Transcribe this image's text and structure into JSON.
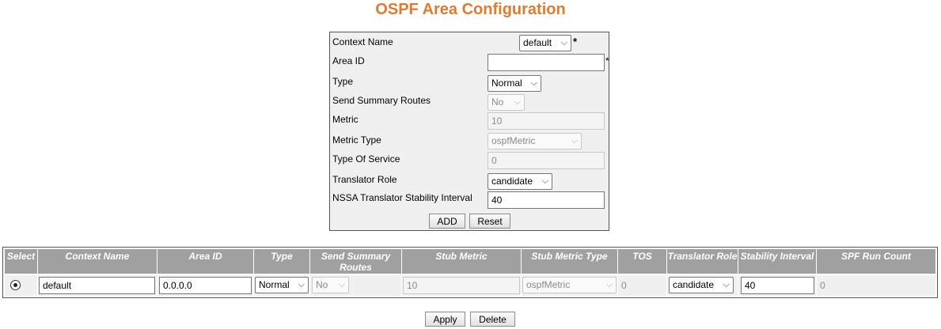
{
  "page": {
    "title": "OSPF Area Configuration"
  },
  "form": {
    "context_name": {
      "label": "Context Name",
      "value": "default",
      "required_mark": "*"
    },
    "area_id": {
      "label": "Area ID",
      "value": "",
      "required_mark": "*"
    },
    "type": {
      "label": "Type",
      "value": "Normal"
    },
    "send_summary_routes": {
      "label": "Send Summary Routes",
      "value": "No"
    },
    "metric": {
      "label": "Metric",
      "value": "10"
    },
    "metric_type": {
      "label": "Metric Type",
      "value": "ospfMetric"
    },
    "type_of_service": {
      "label": "Type Of Service",
      "value": "0"
    },
    "translator_role": {
      "label": "Translator Role",
      "value": "candidate"
    },
    "nssa_stability_interval": {
      "label": "NSSA Translator Stability Interval",
      "value": "40"
    },
    "add_label": "ADD",
    "reset_label": "Reset"
  },
  "table": {
    "headers": {
      "select": "Select",
      "context_name": "Context Name",
      "area_id": "Area ID",
      "type": "Type",
      "send_summary_routes": "Send Summary Routes",
      "stub_metric": "Stub Metric",
      "stub_metric_type": "Stub Metric Type",
      "tos": "TOS",
      "translator_role": "Translator Role",
      "stability_interval": "Stability Interval",
      "spf_run_count": "SPF Run Count"
    },
    "rows": [
      {
        "selected": true,
        "context_name": "default",
        "area_id": "0.0.0.0",
        "type": "Normal",
        "send_summary_routes": "No",
        "stub_metric": "10",
        "stub_metric_type": "ospfMetric",
        "tos": "0",
        "translator_role": "candidate",
        "stability_interval": "40",
        "spf_run_count": "0"
      }
    ]
  },
  "actions": {
    "apply_label": "Apply",
    "delete_label": "Delete"
  },
  "icons": {
    "dropdown": "chevron-down-icon",
    "radio": "radio-selected-icon"
  },
  "colors": {
    "title": "#e07a2e",
    "header_bg": "#a0a0a0",
    "form_bg": "#f0f0f0"
  }
}
